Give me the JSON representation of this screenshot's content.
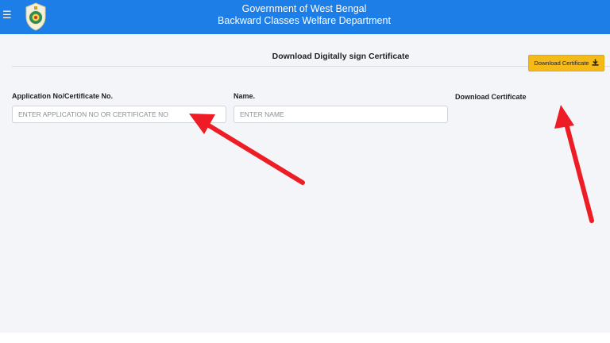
{
  "header": {
    "title_line1": "Government of West Bengal",
    "title_line2": "Backward Classes Welfare Department",
    "menu_icon": "hamburger-menu-icon",
    "emblem_icon": "west-bengal-emblem-icon",
    "background_color": "#1e7ee8"
  },
  "main": {
    "section_title": "Download Digitally sign Certificate",
    "application_field": {
      "label": "Application No/Certificate No.",
      "placeholder": "ENTER APPLICATION NO OR CERTIFICATE NO",
      "value": ""
    },
    "name_field": {
      "label": "Name.",
      "placeholder": "ENTER NAME",
      "value": ""
    },
    "download": {
      "label": "Download Certificate",
      "button_label": "Download Certificate",
      "button_icon": "download-icon",
      "button_color": "#f5b918"
    }
  },
  "annotations": {
    "arrow_color": "#ee1c24"
  }
}
